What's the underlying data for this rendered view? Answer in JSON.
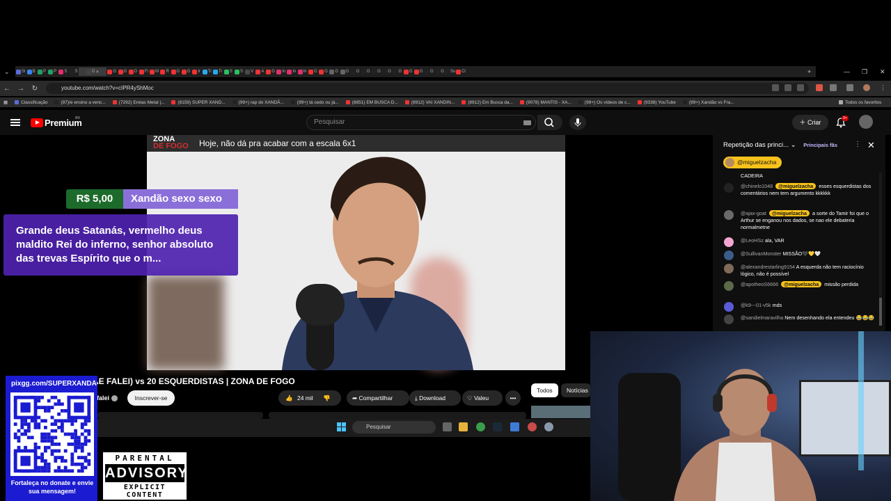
{
  "browser": {
    "url": "youtube.com/watch?v=cIPR4yShMoc",
    "tab_labels": [
      "Sl",
      "B",
      "P",
      "P",
      "S",
      "S",
      "G",
      "G",
      "G",
      "D",
      "Fi",
      "M",
      "R",
      "G",
      "G",
      "Ir",
      "Tr",
      "Tr",
      "S",
      "S",
      "V",
      "A",
      "G",
      "In",
      "In",
      "In",
      "G",
      "G",
      "G",
      "G",
      "G",
      "G",
      "G",
      "G",
      "G",
      "G",
      "G",
      "G",
      "G",
      "Su",
      "Cl"
    ],
    "new_tab": "+",
    "bookmarks": [
      "Classificação",
      "(97)/e ensino a venc...",
      "(7292) Enéas Metal |...",
      "(8159) SUPER XAND...",
      "(99+) rap do XANDÃ...",
      "(99+) tá cedo ou já...",
      "(8851) EM BUSCA D...",
      "(8912) VAI XANDIN...",
      "(8912) Em Busca da...",
      "(9078) MANTIS - XA...",
      "(99+) Os vídeos de c...",
      "(9338) YouTube",
      "(99+) Xandão vs Fra..."
    ],
    "all_bookmarks": "Todos os favoritos"
  },
  "youtube": {
    "brand": "Premium",
    "region": "BR",
    "search_placeholder": "Pesquisar",
    "create_label": "Criar",
    "notifications_badge": "9+"
  },
  "video": {
    "overlay_logo_line1": "ZONA",
    "overlay_logo_line2": "DE FOGO",
    "overlay_title": "Hoje, não dá pra acabar com a escala 6x1",
    "title": "ÃE FALEI) vs 20 ESQUERDISTAS | ZONA DE FOGO",
    "channel": "falei",
    "subscribe_label": "Inscrever-se",
    "likes": "24 mil",
    "share_label": "Compartilhar",
    "download_label": "Download",
    "thanks_label": "Valeu",
    "more_label": "•••",
    "chips": [
      "Todos",
      "Notícias"
    ]
  },
  "superchat": {
    "amount": "R$ 5,00",
    "name": "Xandão sexo sexo",
    "message": "Grande deus Satanás, vermelho deus maldito Rei do inferno, senhor absoluto das trevas Espírito que o m..."
  },
  "chat": {
    "title": "Repetição das princi...",
    "fans_label": "Principais fãs",
    "pinned_user": "@miguelzacha",
    "first_line": "CADEIRA",
    "messages": [
      {
        "user": "@chinelo1048",
        "tag": "@miguelzacha",
        "text": "esses esquerdistas dos comentários nem tem argumento kkkkkk",
        "avatar": "#222222"
      },
      {
        "user": "@ajax-goat",
        "tag": "@miguelzacha",
        "text": "a sorte do Tamir foi que o Arthur se enganou nos dados, se nao ele debateria normalmetne",
        "avatar": "#6a6a6a"
      },
      {
        "user": "@LeoHSz",
        "tag": "",
        "text": "ala, VAR",
        "avatar": "#f3a6d2"
      },
      {
        "user": "@SullivanMonster",
        "tag": "",
        "text": "MISSÃO🖤💛🤍",
        "avatar": "#3a5d8a"
      },
      {
        "user": "@alexandrestarling9154",
        "tag": "",
        "text": "A esquerda não tem raciocínio lógico, não é possível",
        "avatar": "#7f6a5a"
      },
      {
        "user": "@apotheoS6666",
        "tag": "@miguelzacha",
        "text": "missão perdida",
        "avatar": "#5d6a4a"
      },
      {
        "user": "@k9---01-v5k",
        "tag": "",
        "text": "mds",
        "avatar": "#5b5bd6"
      },
      {
        "user": "@sandielmaravilha",
        "tag": "",
        "text": "Nem desenhando ela entendeu 😂😂😂",
        "avatar": "#444444"
      }
    ]
  },
  "taskbar": {
    "search_placeholder": "Pesquisar"
  },
  "donate": {
    "url": "pixgg.com/SUPERXANDÃO",
    "text": "Fortaleça no donate e envie sua mensagem!"
  },
  "advisory": {
    "line1": "PARENTAL",
    "line2": "ADVISORY",
    "line3": "EXPLICIT CONTENT"
  },
  "colors": {
    "youtube_red": "#ff0000",
    "superchat_amount_bg": "#1c6b2b",
    "superchat_name_bg": "#8b6fd9",
    "superchat_msg_bg": "#4e22af",
    "pinned_tag": "#f7c21b",
    "donate_bg": "#1b1bd1"
  }
}
